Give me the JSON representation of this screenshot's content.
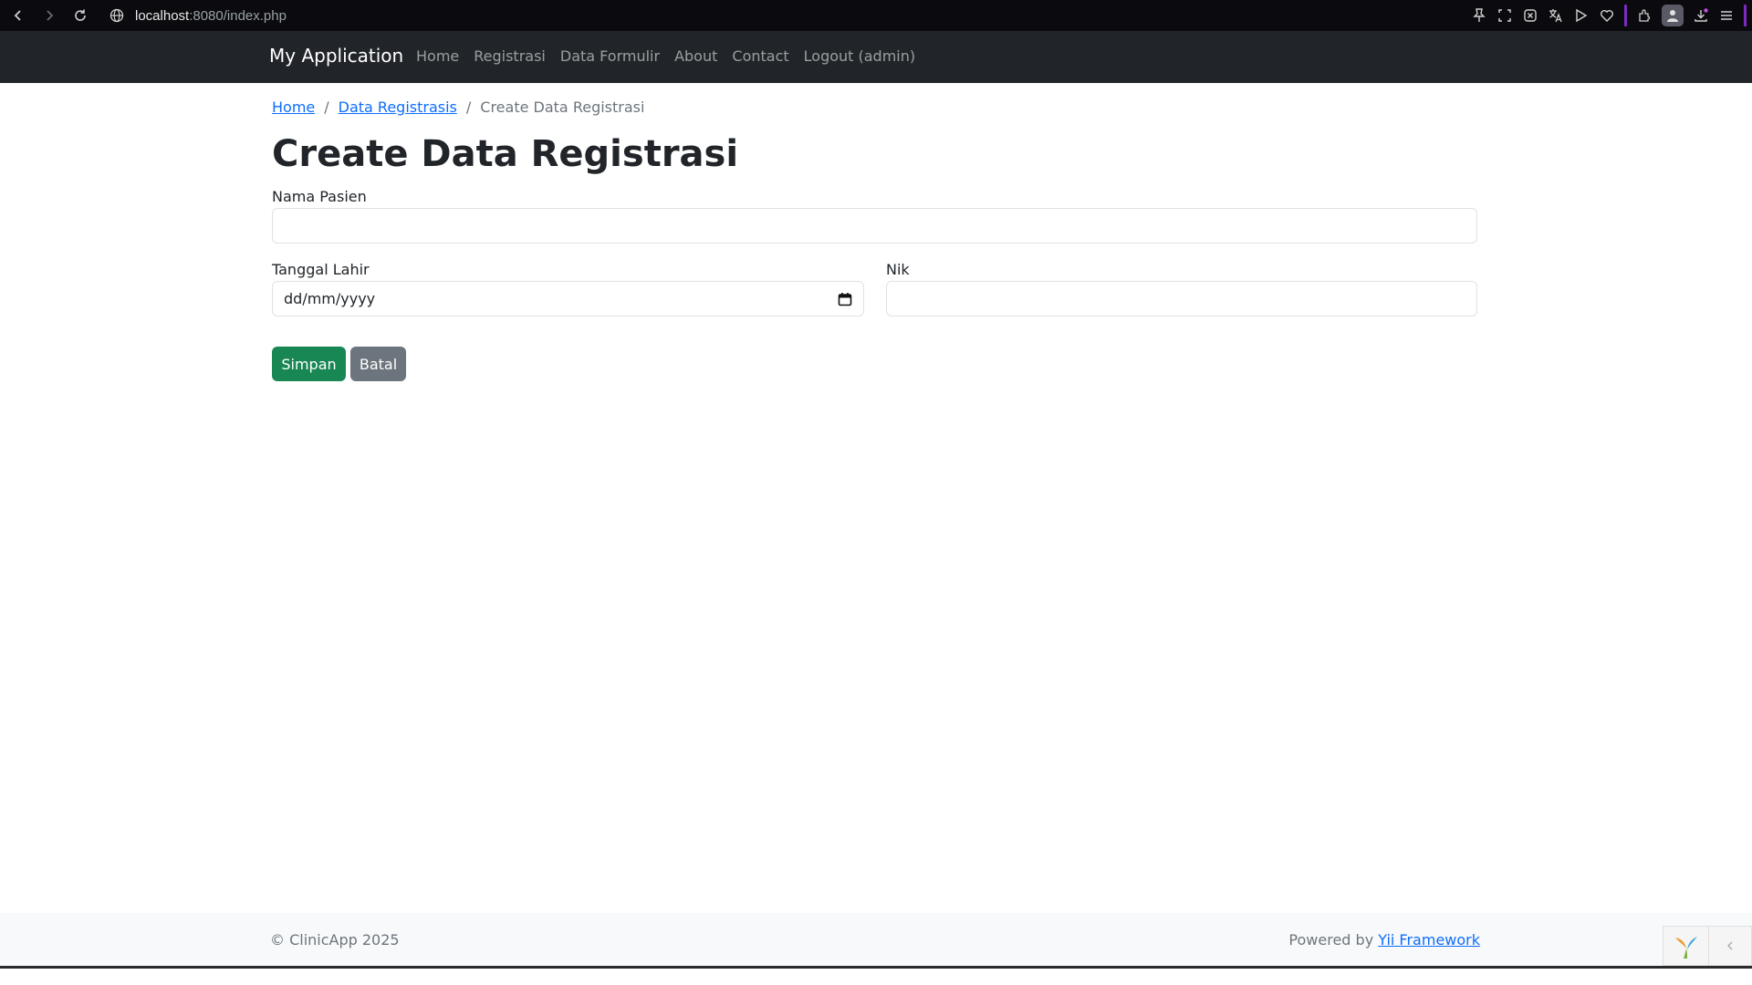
{
  "browser": {
    "url_host": "localhost",
    "url_rest": ":8080/index.php"
  },
  "navbar": {
    "brand": "My Application",
    "links": [
      "Home",
      "Registrasi",
      "Data Formulir",
      "About",
      "Contact",
      "Logout (admin)"
    ]
  },
  "breadcrumb": {
    "home": "Home",
    "parent": "Data Registrasis",
    "current": "Create Data Registrasi",
    "separator": "/"
  },
  "page": {
    "title": "Create Data Registrasi"
  },
  "form": {
    "nama_pasien_label": "Nama Pasien",
    "nama_pasien_value": "",
    "tanggal_lahir_label": "Tanggal Lahir",
    "tanggal_lahir_placeholder": "dd/mm/yyyy",
    "nik_label": "Nik",
    "nik_value": "",
    "save_label": "Simpan",
    "cancel_label": "Batal"
  },
  "footer": {
    "copyright": "© ClinicApp 2025",
    "powered_prefix": "Powered by ",
    "powered_link": "Yii Framework"
  },
  "colors": {
    "navbar_bg": "#212529",
    "link": "#0d6efd",
    "save_button": "#198754",
    "cancel_button": "#6c757d"
  },
  "icons": {
    "browser": [
      "back-icon",
      "forward-icon",
      "reload-icon",
      "site-info-icon"
    ],
    "extensions": [
      "pin-icon",
      "screenshot-icon",
      "shield-icon",
      "translate-icon",
      "play-icon",
      "heart-icon",
      "extensions-icon",
      "profile-icon",
      "download-icon",
      "menu-icon"
    ],
    "form": [
      "calendar-icon"
    ],
    "footer": [
      "yii-logo-icon",
      "chevron-left-icon"
    ]
  }
}
